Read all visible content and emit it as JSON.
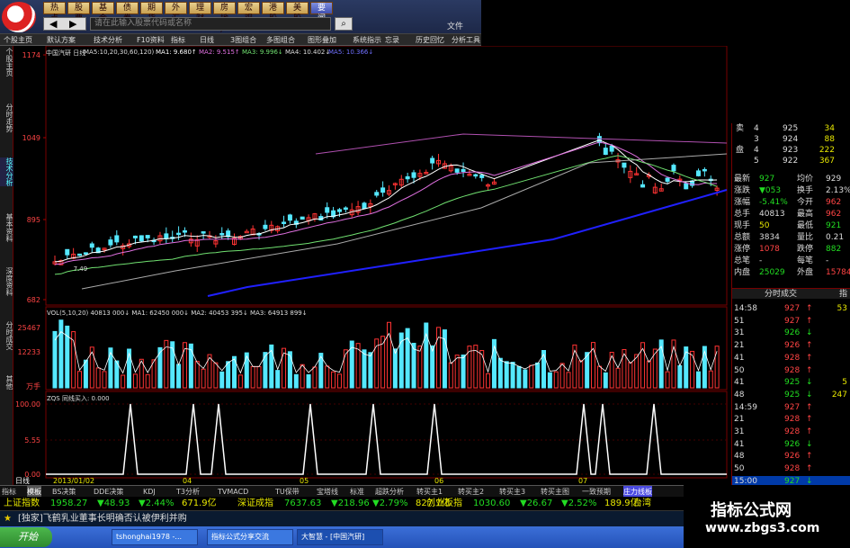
{
  "menu": [
    "热点",
    "股票",
    "基金",
    "债券",
    "期货",
    "外汇",
    "理财",
    "房地产",
    "宏观",
    "港股",
    "美股",
    "要闻"
  ],
  "search_placeholder": "请在此输入股票代码或名称",
  "text_button": "文件",
  "toolbar": [
    "个股主页",
    "默认方案",
    "技术分析",
    "F10资料",
    "指标",
    "日线",
    "3图组合",
    "多图组合",
    "图形叠加",
    "系统指示",
    "忘录",
    "历史回忆",
    "分析工具"
  ],
  "left_tabs": [
    "个股主页",
    "分时走势",
    "技术分析",
    "基本资料",
    "深度资料",
    "分时成交",
    "其他"
  ],
  "chart": {
    "title_bar": "中国汽研 日线",
    "ma_labels": [
      "MA5:10,20,30,60,120)",
      "MA1: 9.680↑",
      "MA2: 9.515↑",
      "MA3: 9.996↓",
      "MA4: 10.402↓",
      "MA5: 10.366↓"
    ],
    "price_ticks": [
      "1174",
      "1049",
      "895",
      "682"
    ],
    "vol_title": "VOL(5,10,20) 40813 000↓ MA1: 62450 000↓ MA2: 40453 395↓ MA3: 64913 899↓",
    "vol_ticks": [
      "25467",
      "12233",
      "万手"
    ],
    "ind_title": "ZQS 同线买入: 0.000",
    "ind_ticks": [
      "100.00",
      "5.55",
      "0.00"
    ],
    "low_price_label": "7.49",
    "date_labels": [
      "日线",
      "2013/01/02",
      "04",
      "05",
      "06",
      "07"
    ],
    "colors": {
      "up": "#ff3333",
      "down": "#55e8ff",
      "ma1": "#ffffff",
      "ma2": "#e070e0",
      "ma3": "#70e070",
      "ma4": "#dddddd",
      "ma5": "#2020ff"
    }
  },
  "order_book": [
    {
      "label": "卖",
      "level": "4",
      "price": "925",
      "vol": "34"
    },
    {
      "label": "",
      "level": "3",
      "price": "924",
      "vol": "88"
    },
    {
      "label": "盘",
      "level": "4",
      "price": "923",
      "vol": "222"
    },
    {
      "label": "",
      "level": "5",
      "price": "922",
      "vol": "367"
    }
  ],
  "quote": [
    {
      "l1": "最新",
      "v1": "927",
      "l2": "均价",
      "v2": "929"
    },
    {
      "l1": "涨跌",
      "v1": "▼053",
      "l2": "换手",
      "v2": "2.13%"
    },
    {
      "l1": "涨幅",
      "v1": "-5.41%",
      "l2": "今开",
      "v2": "962"
    },
    {
      "l1": "总手",
      "v1": "40813",
      "l2": "最高",
      "v2": "962"
    },
    {
      "l1": "现手",
      "v1": "50",
      "l2": "最低",
      "v2": "921"
    },
    {
      "l1": "总额",
      "v1": "3834",
      "l2": "量比",
      "v2": "0.21"
    },
    {
      "l1": "涨停",
      "v1": "1078",
      "l2": "跌停",
      "v2": "882"
    },
    {
      "l1": "总笔",
      "v1": "-",
      "l2": "每笔",
      "v2": "-"
    },
    {
      "l1": "内盘",
      "v1": "25029",
      "l2": "外盘",
      "v2": "15784"
    }
  ],
  "ticks_header": "分时成交",
  "ticks_header_right": "指",
  "ticks": [
    {
      "time": "14:58",
      "price": "927",
      "dir": "↑",
      "vol": "53"
    },
    {
      "time": "51",
      "price": "927",
      "dir": "↑",
      "vol": ""
    },
    {
      "time": "31",
      "price": "926",
      "dir": "↓",
      "vol": ""
    },
    {
      "time": "21",
      "price": "926",
      "dir": "↑",
      "vol": ""
    },
    {
      "time": "41",
      "price": "928",
      "dir": "↑",
      "vol": ""
    },
    {
      "time": "50",
      "price": "928",
      "dir": "↑",
      "vol": ""
    },
    {
      "time": "41",
      "price": "925",
      "dir": "↓",
      "vol": "5"
    },
    {
      "time": "48",
      "price": "925",
      "dir": "↓",
      "vol": "247"
    },
    {
      "time": "14:59",
      "price": "927",
      "dir": "↑",
      "vol": ""
    },
    {
      "time": "21",
      "price": "928",
      "dir": "↑",
      "vol": ""
    },
    {
      "time": "31",
      "price": "928",
      "dir": "↑",
      "vol": ""
    },
    {
      "time": "41",
      "price": "926",
      "dir": "↓",
      "vol": ""
    },
    {
      "time": "48",
      "price": "926",
      "dir": "↑",
      "vol": ""
    },
    {
      "time": "50",
      "price": "928",
      "dir": "↑",
      "vol": ""
    },
    {
      "time": "15:00",
      "price": "927",
      "dir": "↓",
      "vol": ""
    }
  ],
  "bottom_tabs": [
    "指标",
    "模板",
    "BS决策",
    "DDE决策",
    "KDJ",
    "T3分析",
    "TVMACD",
    "TU保带",
    "宝塔线",
    "标准",
    "超跌分析",
    "转买主1",
    "转买主2",
    "转买主3",
    "转买主图",
    "一致预期",
    "庄力线板"
  ],
  "index_bar": [
    {
      "name": "上证指数",
      "value": "1958.27",
      "chg": "▼48.93",
      "pct": "▼2.44%",
      "amt": "671.9亿"
    },
    {
      "name": "深证成指",
      "value": "7637.63",
      "chg": "▼218.96",
      "pct": "▼2.79%",
      "amt": "827.7亿"
    },
    {
      "name": "创业板指",
      "value": "1030.60",
      "chg": "▼26.67",
      "pct": "▼2.52%",
      "amt": "189.9亿"
    },
    {
      "name": "台湾",
      "value": "",
      "chg": "",
      "pct": "",
      "amt": ""
    }
  ],
  "news": "[独家]飞鹤乳业董事长明确否认被伊利并购",
  "taskbar": {
    "start": "开始",
    "items": [
      "tshonghai1978 -...",
      "指标公式分享交流",
      "大智慧 - [中国汽研]"
    ]
  },
  "watermark": {
    "title": "指标公式网",
    "url": "www.zbgs3.com"
  }
}
